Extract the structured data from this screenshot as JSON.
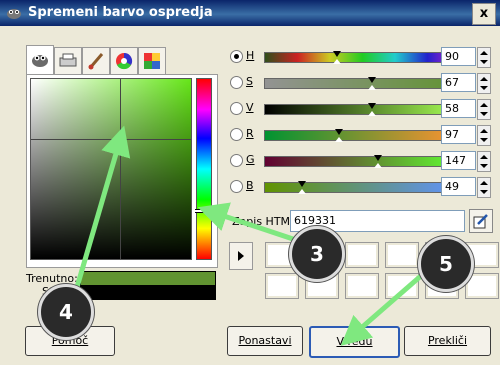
{
  "window": {
    "title": "Spremeni barvo ospredja",
    "close_label": "x",
    "app_icon": "gimp-icon"
  },
  "tabs": [
    {
      "icon": "gimp-selector-icon",
      "selected": true
    },
    {
      "icon": "scanner-icon",
      "selected": false
    },
    {
      "icon": "watercolor-brush-icon",
      "selected": false
    },
    {
      "icon": "color-wheel-icon",
      "selected": false
    },
    {
      "icon": "palette-icon",
      "selected": false
    }
  ],
  "channels": [
    {
      "label": "H",
      "value": "90",
      "selected": true
    },
    {
      "label": "S",
      "value": "67",
      "selected": false
    },
    {
      "label": "V",
      "value": "58",
      "selected": false
    },
    {
      "label": "R",
      "value": "97",
      "selected": false
    },
    {
      "label": "G",
      "value": "147",
      "selected": false
    },
    {
      "label": "B",
      "value": "49",
      "selected": false
    }
  ],
  "html_notation": {
    "label": "Zapis HTML:",
    "value": "619331"
  },
  "swatches": {
    "current_label": "Trenutno:",
    "previous_label": "Staro:",
    "current_color": "#619331",
    "previous_color": "#000000"
  },
  "buttons": {
    "help": "Pomoč",
    "reset": "Ponastavi",
    "ok": "V redu",
    "cancel": "Prekliči"
  },
  "callouts": [
    "3",
    "4",
    "5"
  ],
  "colors": {
    "arrow": "#7fe87f",
    "title_bar": "#0a246a",
    "dialog_bg": "#ece9d8"
  }
}
